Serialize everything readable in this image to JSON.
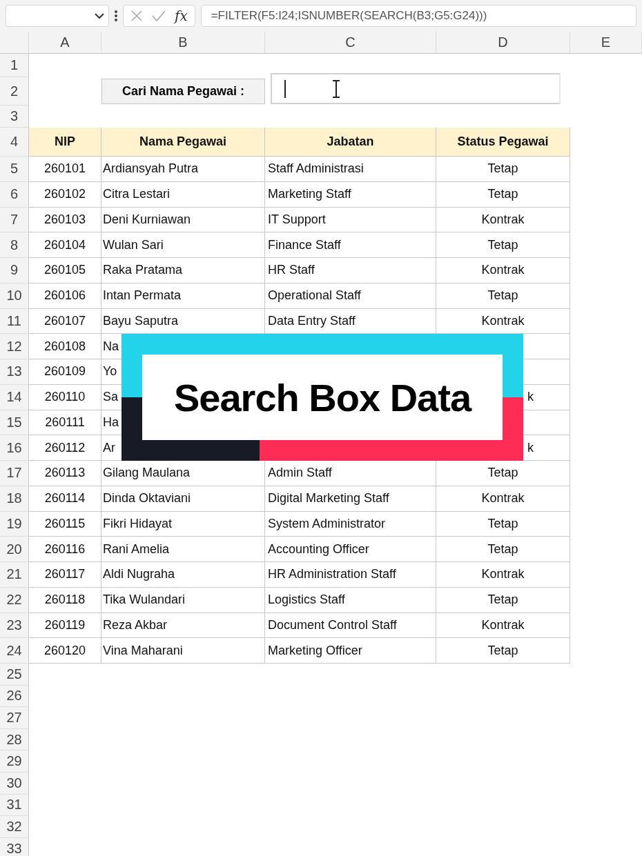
{
  "formula_bar": {
    "fx": "fx",
    "formula": "=FILTER(F5:I24;ISNUMBER(SEARCH(B3;G5:G24)))"
  },
  "column_headers": [
    "A",
    "B",
    "C",
    "D",
    "E"
  ],
  "search_label": "Cari Nama Pegawai :",
  "table": {
    "columns": [
      "NIP",
      "Nama Pegawai",
      "Jabatan",
      "Status Pegawai"
    ],
    "rows": [
      {
        "nip": "260101",
        "name": "Ardiansyah Putra",
        "jabatan": "Staff Administrasi",
        "status": "Tetap"
      },
      {
        "nip": "260102",
        "name": "Citra Lestari",
        "jabatan": "Marketing Staff",
        "status": "Tetap"
      },
      {
        "nip": "260103",
        "name": "Deni Kurniawan",
        "jabatan": "IT Support",
        "status": "Kontrak"
      },
      {
        "nip": "260104",
        "name": "Wulan Sari",
        "jabatan": "Finance Staff",
        "status": "Tetap"
      },
      {
        "nip": "260105",
        "name": "Raka Pratama",
        "jabatan": "HR Staff",
        "status": "Kontrak"
      },
      {
        "nip": "260106",
        "name": "Intan Permata",
        "jabatan": "Operational Staff",
        "status": "Tetap"
      },
      {
        "nip": "260107",
        "name": "Bayu Saputra",
        "jabatan": "Data Entry Staff",
        "status": "Kontrak"
      },
      {
        "nip": "260108",
        "name": "Na"
      },
      {
        "nip": "260109",
        "name": "Yo"
      },
      {
        "nip": "260110",
        "name": "Sa",
        "status": "k"
      },
      {
        "nip": "260111",
        "name": "Ha"
      },
      {
        "nip": "260112",
        "name": "Ar",
        "status": "k"
      },
      {
        "nip": "260113",
        "name": "Gilang Maulana",
        "jabatan": "Admin Staff",
        "status": "Tetap"
      },
      {
        "nip": "260114",
        "name": "Dinda Oktaviani",
        "jabatan": "Digital Marketing Staff",
        "status": "Kontrak"
      },
      {
        "nip": "260115",
        "name": "Fikri Hidayat",
        "jabatan": "System Administrator",
        "status": "Tetap"
      },
      {
        "nip": "260116",
        "name": "Rani Amelia",
        "jabatan": "Accounting Officer",
        "status": "Tetap"
      },
      {
        "nip": "260117",
        "name": "Aldi Nugraha",
        "jabatan": "HR Administration Staff",
        "status": "Kontrak"
      },
      {
        "nip": "260118",
        "name": "Tika Wulandari",
        "jabatan": "Logistics Staff",
        "status": "Tetap"
      },
      {
        "nip": "260119",
        "name": "Reza Akbar",
        "jabatan": "Document Control Staff",
        "status": "Kontrak"
      },
      {
        "nip": "260120",
        "name": "Vina Maharani",
        "jabatan": "Marketing Officer",
        "status": "Tetap"
      }
    ]
  },
  "row_numbers": [
    "1",
    "2",
    "3",
    "4",
    "5",
    "6",
    "7",
    "8",
    "9",
    "10",
    "11",
    "12",
    "13",
    "14",
    "15",
    "16",
    "17",
    "18",
    "19",
    "20",
    "21",
    "22",
    "23",
    "24",
    "25",
    "26",
    "27",
    "28",
    "29",
    "30",
    "31",
    "32",
    "33"
  ],
  "banner": {
    "title": "Search Box Data"
  }
}
